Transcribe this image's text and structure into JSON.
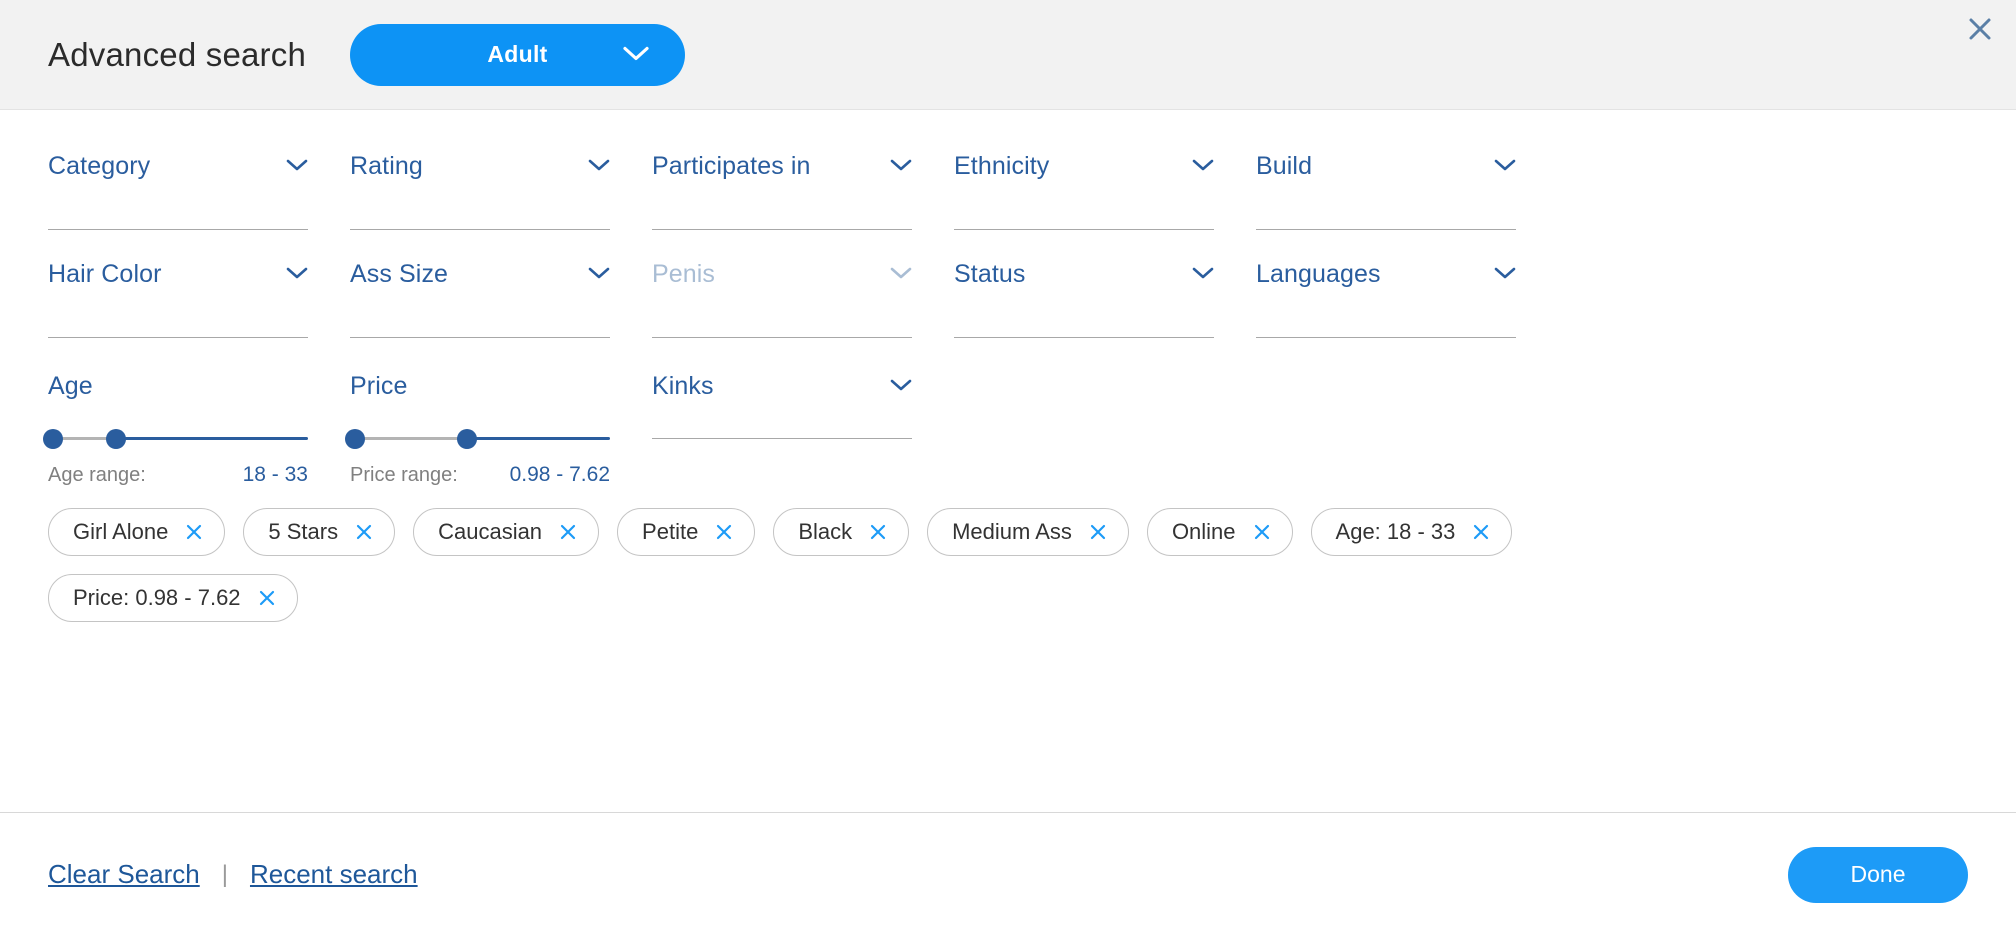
{
  "header": {
    "title": "Advanced search",
    "mode_pill": {
      "label": "Adult",
      "icon": "chevron-down-icon",
      "color": "#0d93f5"
    },
    "close_icon": "close-icon"
  },
  "filters": {
    "row1": [
      {
        "label": "Category",
        "icon": "chevron-down-icon",
        "disabled": false
      },
      {
        "label": "Rating",
        "icon": "chevron-down-icon",
        "disabled": false
      },
      {
        "label": "Participates in",
        "icon": "chevron-down-icon",
        "disabled": false
      },
      {
        "label": "Ethnicity",
        "icon": "chevron-down-icon",
        "disabled": false
      },
      {
        "label": "Build",
        "icon": "chevron-down-icon",
        "disabled": false
      }
    ],
    "row2": [
      {
        "label": "Hair Color",
        "icon": "chevron-down-icon",
        "disabled": false
      },
      {
        "label": "Ass Size",
        "icon": "chevron-down-icon",
        "disabled": false
      },
      {
        "label": "Penis",
        "icon": "chevron-down-icon",
        "disabled": true
      },
      {
        "label": "Status",
        "icon": "chevron-down-icon",
        "disabled": false
      },
      {
        "label": "Languages",
        "icon": "chevron-down-icon",
        "disabled": false
      }
    ],
    "kinks": {
      "label": "Kinks",
      "icon": "chevron-down-icon"
    }
  },
  "sliders": [
    {
      "name": "age",
      "label": "Age",
      "caption": "Age range:",
      "value_text": "18 - 33",
      "low_pct": 0,
      "high_pct": 26
    },
    {
      "name": "price",
      "label": "Price",
      "caption": "Price range:",
      "value_text": "0.98 - 7.62",
      "low_pct": 0,
      "high_pct": 45
    }
  ],
  "chips": [
    {
      "label": "Girl Alone",
      "remove_icon": "close-icon"
    },
    {
      "label": "5 Stars",
      "remove_icon": "close-icon"
    },
    {
      "label": "Caucasian",
      "remove_icon": "close-icon"
    },
    {
      "label": "Petite",
      "remove_icon": "close-icon"
    },
    {
      "label": "Black",
      "remove_icon": "close-icon"
    },
    {
      "label": "Medium Ass",
      "remove_icon": "close-icon"
    },
    {
      "label": "Online",
      "remove_icon": "close-icon"
    },
    {
      "label": "Age: 18 - 33",
      "remove_icon": "close-icon"
    },
    {
      "label": "Price: 0.98 - 7.62",
      "remove_icon": "close-icon"
    }
  ],
  "footer": {
    "clear_search": "Clear Search",
    "separator": "|",
    "recent_search": "Recent search",
    "done": "Done"
  },
  "colors": {
    "accent_blue": "#0d93f5",
    "label_blue": "#2a5d9e",
    "link_blue": "#1e5799",
    "chip_x_blue": "#1d9bf7",
    "disabled_blue": "#a9bdd4",
    "header_bg": "#f2f2f2"
  }
}
